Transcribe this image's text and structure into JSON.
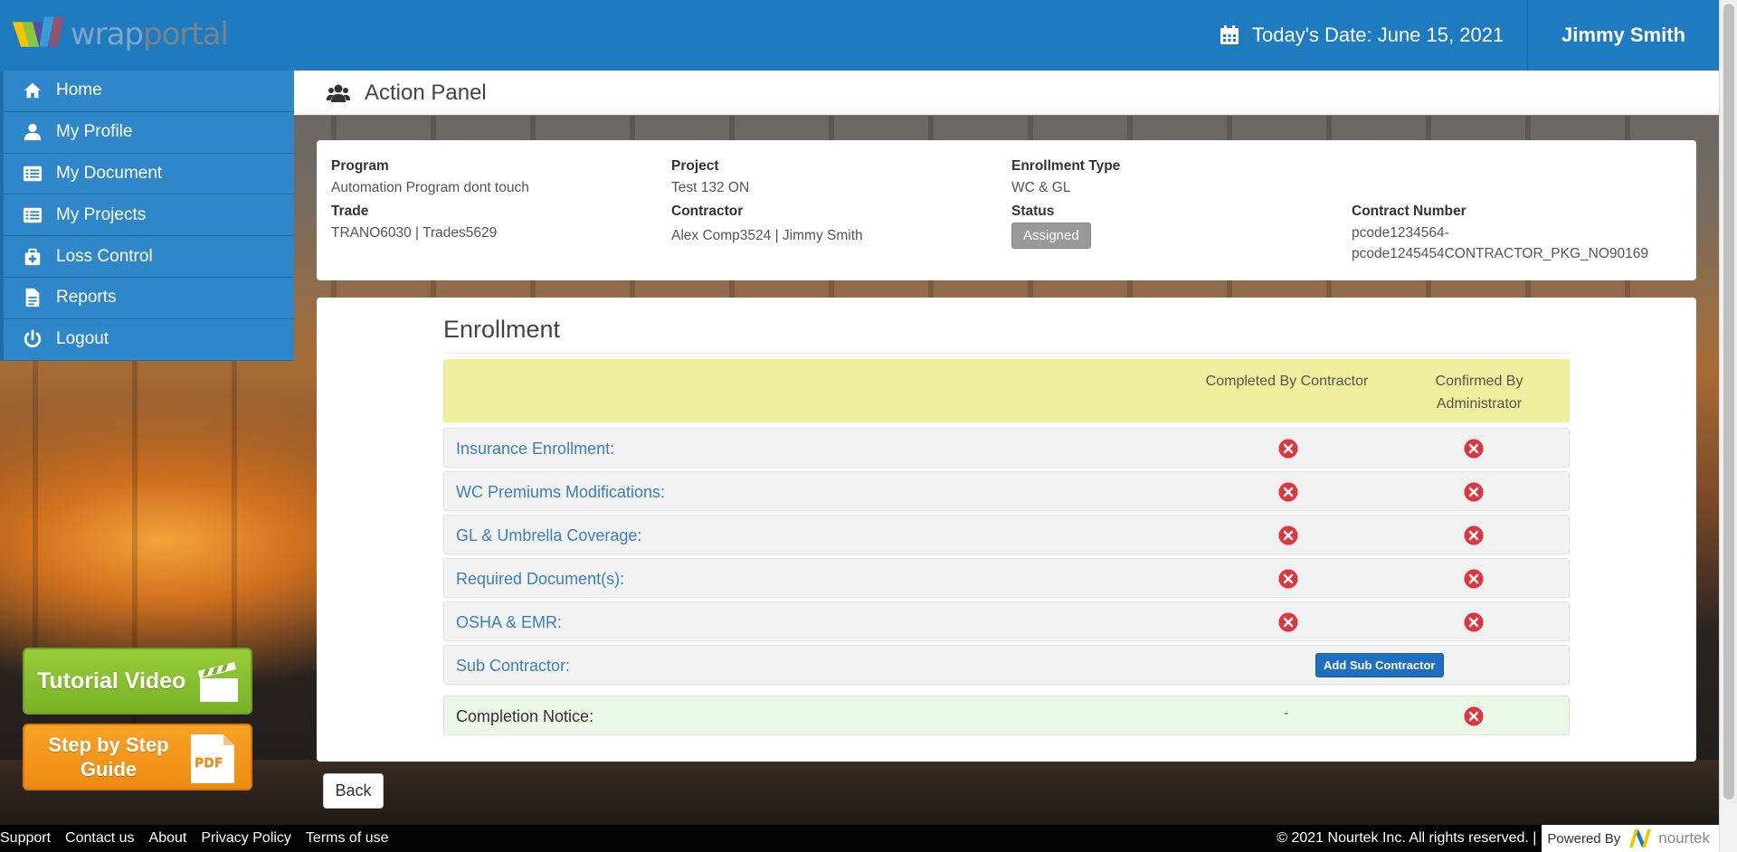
{
  "header": {
    "logo_text_a": "wrap",
    "logo_text_b": "portal",
    "date_label": "Today's Date: June 15, 2021",
    "user_name": "Jimmy Smith"
  },
  "sidebar": {
    "items": [
      {
        "label": "Home",
        "icon": "home-icon"
      },
      {
        "label": "My Profile",
        "icon": "user-icon"
      },
      {
        "label": "My Document",
        "icon": "list-icon"
      },
      {
        "label": "My Projects",
        "icon": "list-icon"
      },
      {
        "label": "Loss Control",
        "icon": "medkit-icon"
      },
      {
        "label": "Reports",
        "icon": "file-icon"
      },
      {
        "label": "Logout",
        "icon": "power-icon"
      }
    ]
  },
  "action_panel": {
    "title": "Action Panel"
  },
  "info": {
    "program_label": "Program",
    "program_value": "Automation Program dont touch",
    "project_label": "Project",
    "project_value": "Test 132 ON",
    "enrollment_type_label": "Enrollment Type",
    "enrollment_type_value": "WC & GL",
    "trade_label": "Trade",
    "trade_value": "TRANO6030 | Trades5629",
    "contractor_label": "Contractor",
    "contractor_value": "Alex Comp3524 | Jimmy Smith",
    "status_label": "Status",
    "status_value": "Assigned",
    "contract_number_label": "Contract Number",
    "contract_number_line1": "pcode1234564-",
    "contract_number_line2": "pcode1245454CONTRACTOR_PKG_NO90169"
  },
  "enrollment": {
    "title": "Enrollment",
    "col_completed": "Completed By Contractor",
    "col_confirmed_1": "Confirmed By",
    "col_confirmed_2": "Administrator",
    "rows": [
      {
        "label": "Insurance Enrollment:"
      },
      {
        "label": "WC Premiums Modifications:"
      },
      {
        "label": "GL & Umbrella Coverage:"
      },
      {
        "label": "Required Document(s):"
      },
      {
        "label": "OSHA & EMR:"
      },
      {
        "label": "Sub Contractor:"
      }
    ],
    "add_sub_label": "Add Sub Contractor",
    "completion_label": "Completion Notice:",
    "completion_dash": "-"
  },
  "buttons": {
    "back": "Back",
    "tutorial": "Tutorial Video",
    "guide_line1": "Step by Step",
    "guide_line2": "Guide",
    "pdf_text": "PDF"
  },
  "footer": {
    "links": [
      "Support",
      "Contact us",
      "About",
      "Privacy Policy",
      "Terms of use"
    ],
    "copyright": "© 2021 Nourtek Inc. All rights reserved. |",
    "powered_by": "Powered By",
    "brand": "nourtek"
  },
  "colors": {
    "header_blue": "#1f7bbf",
    "sidebar_blue": "#2f86c9",
    "status_gray": "#999999",
    "error_red": "#e0353f",
    "header_row_yellow": "#eeee9c",
    "completion_green": "#e9f7e4",
    "tutorial_green": "#8cc233",
    "guide_orange": "#f39a1c"
  }
}
